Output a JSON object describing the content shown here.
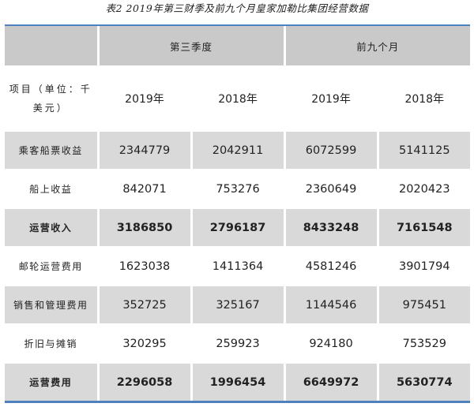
{
  "caption": "表2  2019年第三财季及前九个月皇家加勒比集团经营数据",
  "header": {
    "period_q3": "第三季度",
    "period_9m": "前九个月",
    "unit_label": "项目（单位：千美元）",
    "years": [
      "2019年",
      "2018年",
      "2019年",
      "2018年"
    ]
  },
  "rows": [
    {
      "label": "乘客船票收益",
      "values": [
        "2344779",
        "2042911",
        "6072599",
        "5141125"
      ]
    },
    {
      "label": "船上收益",
      "values": [
        "842071",
        "753276",
        "2360649",
        "2020423"
      ]
    },
    {
      "label": "运营收入",
      "values": [
        "3186850",
        "2796187",
        "8433248",
        "7161548"
      ]
    },
    {
      "label": "邮轮运营费用",
      "values": [
        "1623038",
        "1411364",
        "4581246",
        "3901794"
      ]
    },
    {
      "label": "销售和管理费用",
      "values": [
        "352725",
        "325167",
        "1144546",
        "975451"
      ]
    },
    {
      "label": "折旧与摊销",
      "values": [
        "320295",
        "259923",
        "924180",
        "753529"
      ]
    },
    {
      "label": "运营费用",
      "values": [
        "2296058",
        "1996454",
        "6649972",
        "5630774"
      ]
    }
  ],
  "colors": {
    "accent_rule": "#4f81bd",
    "gray_band": "#d9d9d9",
    "header_band": "#c9c9c9"
  }
}
